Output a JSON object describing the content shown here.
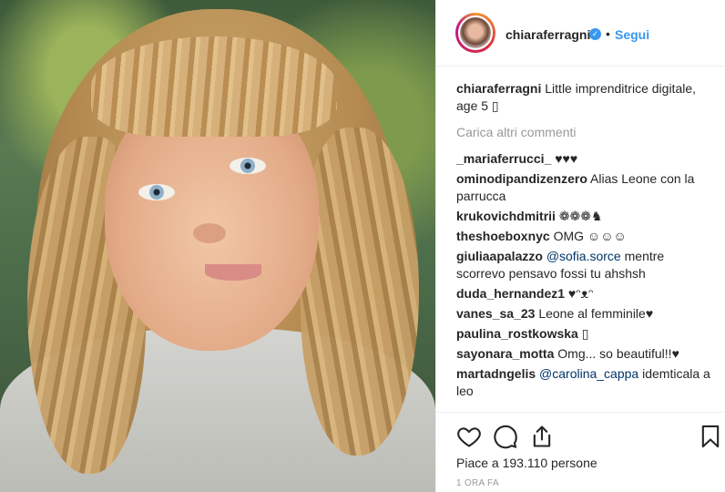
{
  "post": {
    "username": "chiaraferragni",
    "follow_separator": "•",
    "follow_label": "Segui",
    "verified_icon": "verified-badge-icon",
    "caption": {
      "user": "chiaraferragni",
      "text": "Little imprenditrice digitale, age 5 ▯"
    },
    "load_more": "Carica altri commenti",
    "comments": [
      {
        "user": "_mariaferrucci_",
        "parts": [
          {
            "t": "♥♥♥",
            "m": false
          }
        ]
      },
      {
        "user": "ominodipandizenzero",
        "parts": [
          {
            "t": "Alias Leone con la parrucca",
            "m": false
          }
        ]
      },
      {
        "user": "krukovichdmitrii",
        "parts": [
          {
            "t": "❁❁❁♞",
            "m": false
          }
        ]
      },
      {
        "user": "theshoeboxnyc",
        "parts": [
          {
            "t": "OMG ☺☺☺",
            "m": false
          }
        ]
      },
      {
        "user": "giuliaapalazzo",
        "parts": [
          {
            "t": "@sofia.sorce",
            "m": true
          },
          {
            "t": " mentre scorrevo pensavo fossi tu ahshsh",
            "m": false
          }
        ]
      },
      {
        "user": "duda_hernandez1",
        "parts": [
          {
            "t": "♥ᵔᴥᵔ",
            "m": false
          }
        ]
      },
      {
        "user": "vanes_sa_23",
        "parts": [
          {
            "t": "Leone al femminile♥",
            "m": false
          }
        ]
      },
      {
        "user": "paulina_rostkowska",
        "parts": [
          {
            "t": "▯",
            "m": false
          }
        ]
      },
      {
        "user": "sayonara_motta",
        "parts": [
          {
            "t": "Omg... so beautiful!!♥",
            "m": false
          }
        ]
      },
      {
        "user": "martadngelis",
        "parts": [
          {
            "t": "@carolina_cappa",
            "m": true
          },
          {
            "t": " idemticala a leo",
            "m": false
          }
        ]
      }
    ],
    "likes_text": "Piace a 193.110 persone",
    "time_text": "1 ORA FA",
    "icons": [
      "heart-icon",
      "comment-icon",
      "share-icon",
      "bookmark-icon"
    ],
    "colors": {
      "link": "#3897f0",
      "mention": "#003569",
      "muted": "#999999",
      "text": "#262626"
    }
  }
}
